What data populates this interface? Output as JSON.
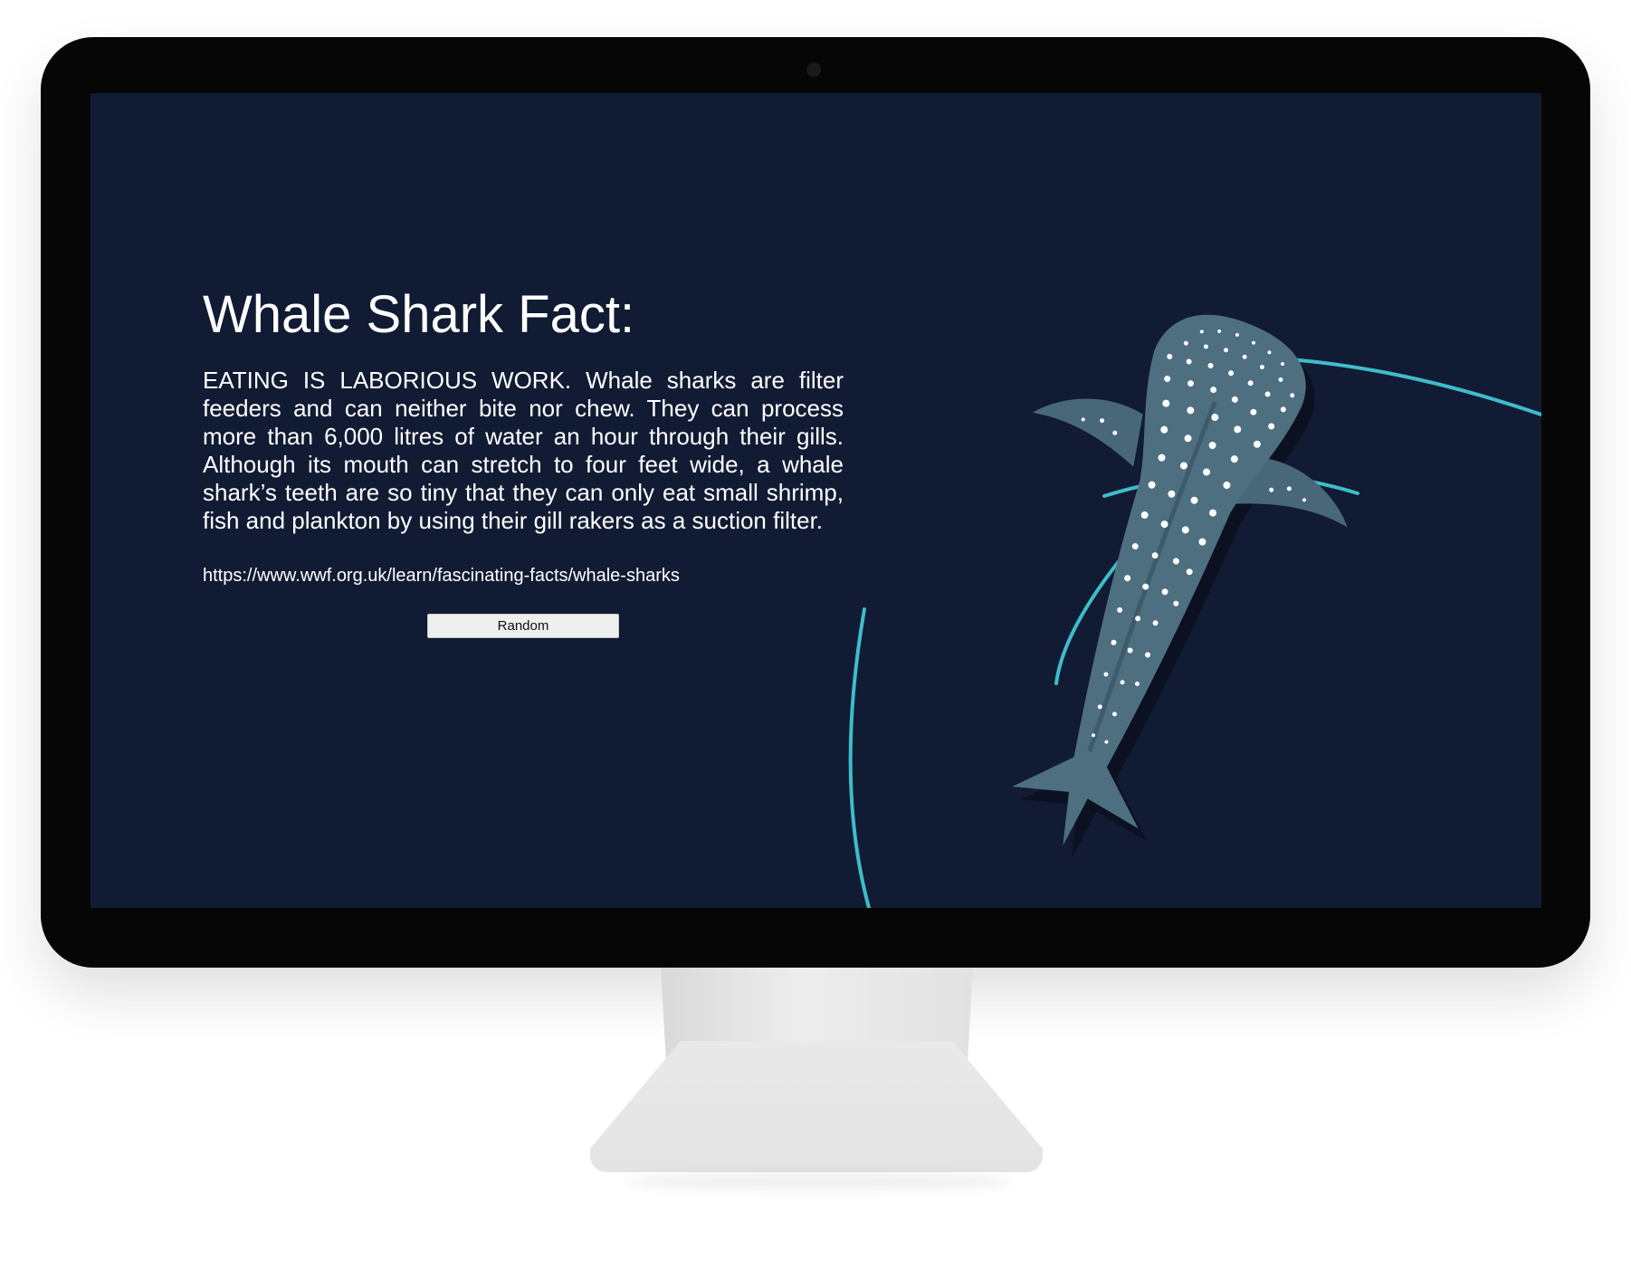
{
  "page": {
    "title": "Whale Shark Fact:",
    "fact_text": "EATING IS LABORIOUS WORK. Whale sharks are filter feeders and can neither bite nor chew. They can process more than 6,000 litres of water an hour through their gills. Although its mouth can stretch to four feet wide, a whale shark’s teeth are so tiny that they can only eat small shrimp, fish and plankton by using their gill rakers as a suction filter.",
    "source_link": "https://www.wwf.org.uk/learn/fascinating-facts/whale-sharks",
    "random_button_label": "Random"
  },
  "colors": {
    "screen_background": "#111b33",
    "text": "#ffffff",
    "arc_accent": "#3fbcc9",
    "shark_body": "#4e6f80"
  },
  "icons": {
    "illustration": "whale-shark-illustration",
    "camera": "camera-icon"
  }
}
